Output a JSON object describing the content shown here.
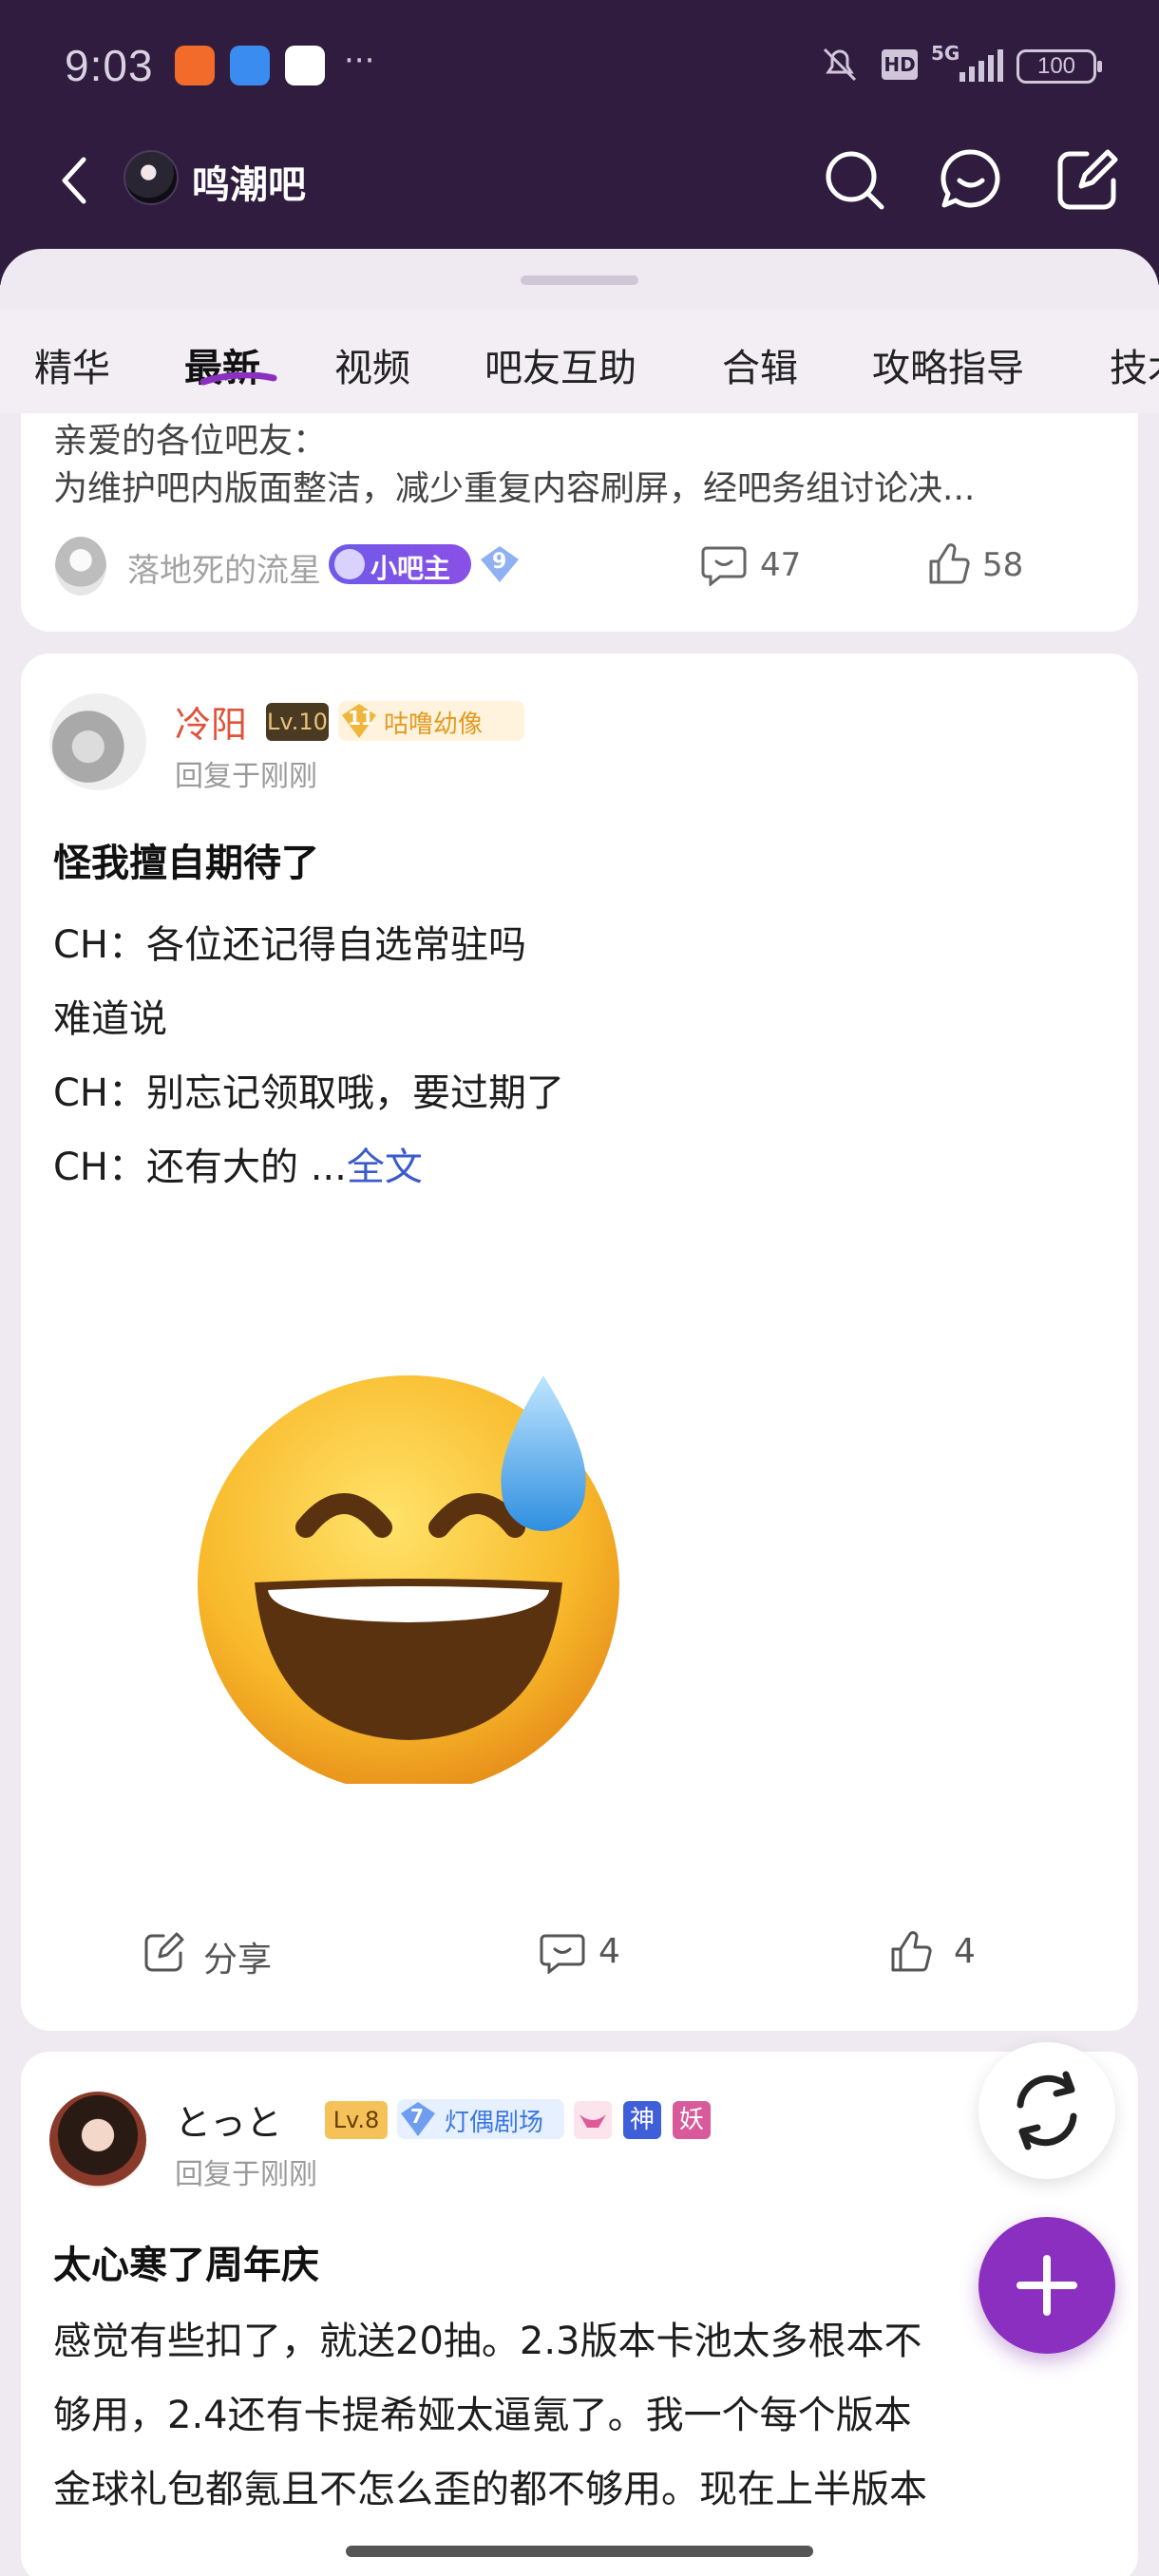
{
  "status_bar": {
    "time": "9:03",
    "more_dots": "···",
    "battery": "100",
    "network": "5G",
    "hd": "HD"
  },
  "nav": {
    "title": "鸣潮吧"
  },
  "tabs": [
    {
      "label": "精华"
    },
    {
      "label": "最新"
    },
    {
      "label": "视频"
    },
    {
      "label": "吧友互助"
    },
    {
      "label": "合辑"
    },
    {
      "label": "攻略指导"
    },
    {
      "label": "技术"
    }
  ],
  "pinned_post": {
    "line1": "亲爱的各位吧友：",
    "line2": "为维护吧内版面整洁，减少重复内容刷屏，经吧务组讨论决...",
    "author": "落地死的流星",
    "role_badge": "小吧主",
    "level": "9",
    "comments": "47",
    "likes": "58"
  },
  "post1": {
    "author": "冷阳",
    "level_badge": "Lv.10",
    "fan_level": "11",
    "fan_title": "咕噜幼像",
    "reply_time": "回复于刚刚",
    "title": "怪我擅自期待了",
    "lines": [
      "CH：各位还记得自选常驻吗",
      "难道说",
      "CH：别忘记领取哦，要过期了",
      "CH：还有大的 ..."
    ],
    "more": "全文",
    "share": "分享",
    "comments": "4",
    "likes": "4"
  },
  "post2": {
    "author": "とっと",
    "level_badge": "Lv.8",
    "fan_level": "7",
    "fan_title": "灯偶剧场",
    "tag1": "神",
    "tag2": "妖",
    "reply_time": "回复于刚刚",
    "title": "太心寒了周年庆",
    "lines": [
      "感觉有些扣了，就送20抽。2.3版本卡池太多根本不",
      "够用，2.4还有卡提希娅太逼氪了。我一个每个版本",
      "金球礼包都氪且不怎么歪的都不够用。现在上半版本"
    ]
  },
  "colors": {
    "header_bg": "#2f1c3e",
    "accent": "#8a2fbf",
    "link": "#3b5bcc",
    "username_red": "#e0523a"
  }
}
